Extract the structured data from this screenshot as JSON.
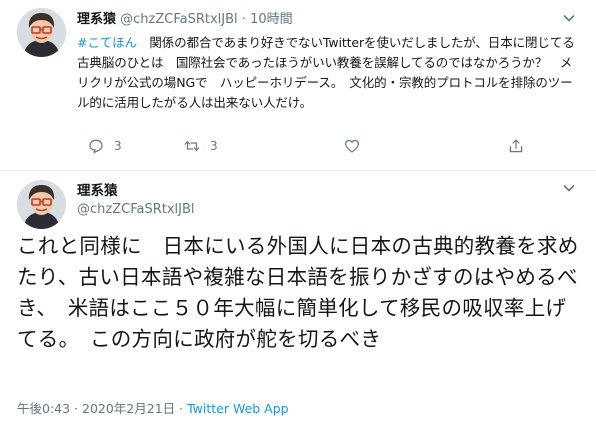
{
  "tweet1": {
    "name": "理系猿",
    "handle": "@chzZCFaSRtxlJBl",
    "separator": "·",
    "time": "10時間",
    "hashtag": "#こてほん",
    "text": "　関係の都合であまり好きでないTwitterを使いだしましたが、日本に閉じてる古典脳のひとは　国際社会であったほうがいい教養を誤解してるのではなかろうか？　メリクリが公式の場NGで　ハッピーホリデース。　文化的・宗教的プロトコルを排除のツール的に活用したがる人は出来ない人だけ。",
    "reply_count": "3",
    "retweet_count": "3",
    "like_count": "",
    "icons": [
      "reply-icon",
      "retweet-icon",
      "heart-icon",
      "share-icon",
      "chevron-down-icon"
    ]
  },
  "tweet2": {
    "name": "理系猿",
    "handle": "@chzZCFaSRtxlJBl",
    "text": "これと同様に　日本にいる外国人に日本の古典的教養を求めたり、古い日本語や複雑な日本語を振りかざすのはやめるべき、　米語はここ５０年大幅に簡単化して移民の吸収率上げてる。　この方向に政府が舵を切るべき",
    "timestamp": "午後0:43 · 2020年2月21日 · ",
    "client": "Twitter Web App"
  },
  "colors": {
    "link": "#1b95e0",
    "secondary_text": "#657786",
    "primary_text": "#14171a",
    "divider": "#e6ecf0"
  }
}
